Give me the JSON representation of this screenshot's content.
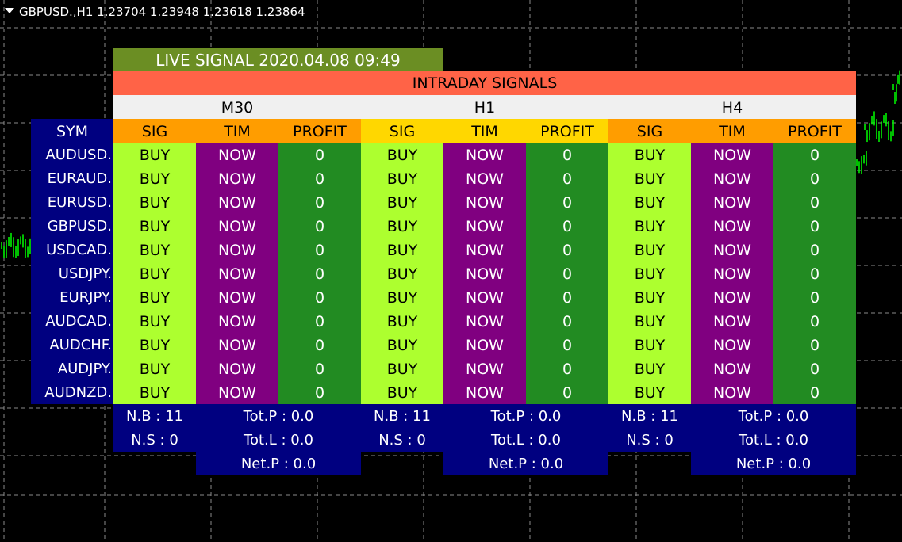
{
  "chart": {
    "title": "GBPUSD.,H1  1.23704 1.23948 1.23618 1.23864",
    "menu_icon": "triangle-down-icon"
  },
  "panel": {
    "live_signal": "LIVE SIGNAL 2020.04.08 09:49",
    "heading": "INTRADAY SIGNALS",
    "sym_header": "SYM",
    "col_headers": [
      "SIG",
      "TIM",
      "PROFIT"
    ],
    "timeframes": [
      {
        "name": "M30",
        "nb": "N.B : 11",
        "ns": "N.S : 0",
        "totp": "Tot.P : 0.0",
        "totl": "Tot.L : 0.0",
        "netp": "Net.P : 0.0"
      },
      {
        "name": "H1",
        "nb": "N.B : 11",
        "ns": "N.S : 0",
        "totp": "Tot.P : 0.0",
        "totl": "Tot.L : 0.0",
        "netp": "Net.P : 0.0"
      },
      {
        "name": "H4",
        "nb": "N.B : 11",
        "ns": "N.S : 0",
        "totp": "Tot.P : 0.0",
        "totl": "Tot.L : 0.0",
        "netp": "Net.P : 0.0"
      }
    ],
    "rows": [
      {
        "sym": "AUDUSD.",
        "cells": [
          [
            "BUY",
            "NOW",
            "0"
          ],
          [
            "BUY",
            "NOW",
            "0"
          ],
          [
            "BUY",
            "NOW",
            "0"
          ]
        ]
      },
      {
        "sym": "EURAUD.",
        "cells": [
          [
            "BUY",
            "NOW",
            "0"
          ],
          [
            "BUY",
            "NOW",
            "0"
          ],
          [
            "BUY",
            "NOW",
            "0"
          ]
        ]
      },
      {
        "sym": "EURUSD.",
        "cells": [
          [
            "BUY",
            "NOW",
            "0"
          ],
          [
            "BUY",
            "NOW",
            "0"
          ],
          [
            "BUY",
            "NOW",
            "0"
          ]
        ]
      },
      {
        "sym": "GBPUSD.",
        "cells": [
          [
            "BUY",
            "NOW",
            "0"
          ],
          [
            "BUY",
            "NOW",
            "0"
          ],
          [
            "BUY",
            "NOW",
            "0"
          ]
        ]
      },
      {
        "sym": "USDCAD.",
        "cells": [
          [
            "BUY",
            "NOW",
            "0"
          ],
          [
            "BUY",
            "NOW",
            "0"
          ],
          [
            "BUY",
            "NOW",
            "0"
          ]
        ]
      },
      {
        "sym": "USDJPY.",
        "cells": [
          [
            "BUY",
            "NOW",
            "0"
          ],
          [
            "BUY",
            "NOW",
            "0"
          ],
          [
            "BUY",
            "NOW",
            "0"
          ]
        ]
      },
      {
        "sym": "EURJPY.",
        "cells": [
          [
            "BUY",
            "NOW",
            "0"
          ],
          [
            "BUY",
            "NOW",
            "0"
          ],
          [
            "BUY",
            "NOW",
            "0"
          ]
        ]
      },
      {
        "sym": "AUDCAD.",
        "cells": [
          [
            "BUY",
            "NOW",
            "0"
          ],
          [
            "BUY",
            "NOW",
            "0"
          ],
          [
            "BUY",
            "NOW",
            "0"
          ]
        ]
      },
      {
        "sym": "AUDCHF.",
        "cells": [
          [
            "BUY",
            "NOW",
            "0"
          ],
          [
            "BUY",
            "NOW",
            "0"
          ],
          [
            "BUY",
            "NOW",
            "0"
          ]
        ]
      },
      {
        "sym": "AUDJPY.",
        "cells": [
          [
            "BUY",
            "NOW",
            "0"
          ],
          [
            "BUY",
            "NOW",
            "0"
          ],
          [
            "BUY",
            "NOW",
            "0"
          ]
        ]
      },
      {
        "sym": "AUDNZD.",
        "cells": [
          [
            "BUY",
            "NOW",
            "0"
          ],
          [
            "BUY",
            "NOW",
            "0"
          ],
          [
            "BUY",
            "NOW",
            "0"
          ]
        ]
      }
    ]
  },
  "colors": {
    "background": "#000000",
    "grid": "#8a8a8a",
    "candles": "#00ff00",
    "live_signal_bg": "#6b8e23",
    "heading_bg": "#ff6347",
    "sig_bg": "#adff2f",
    "tim_bg": "#800080",
    "profit_bg": "#228b22",
    "panel_blue": "#000080"
  }
}
